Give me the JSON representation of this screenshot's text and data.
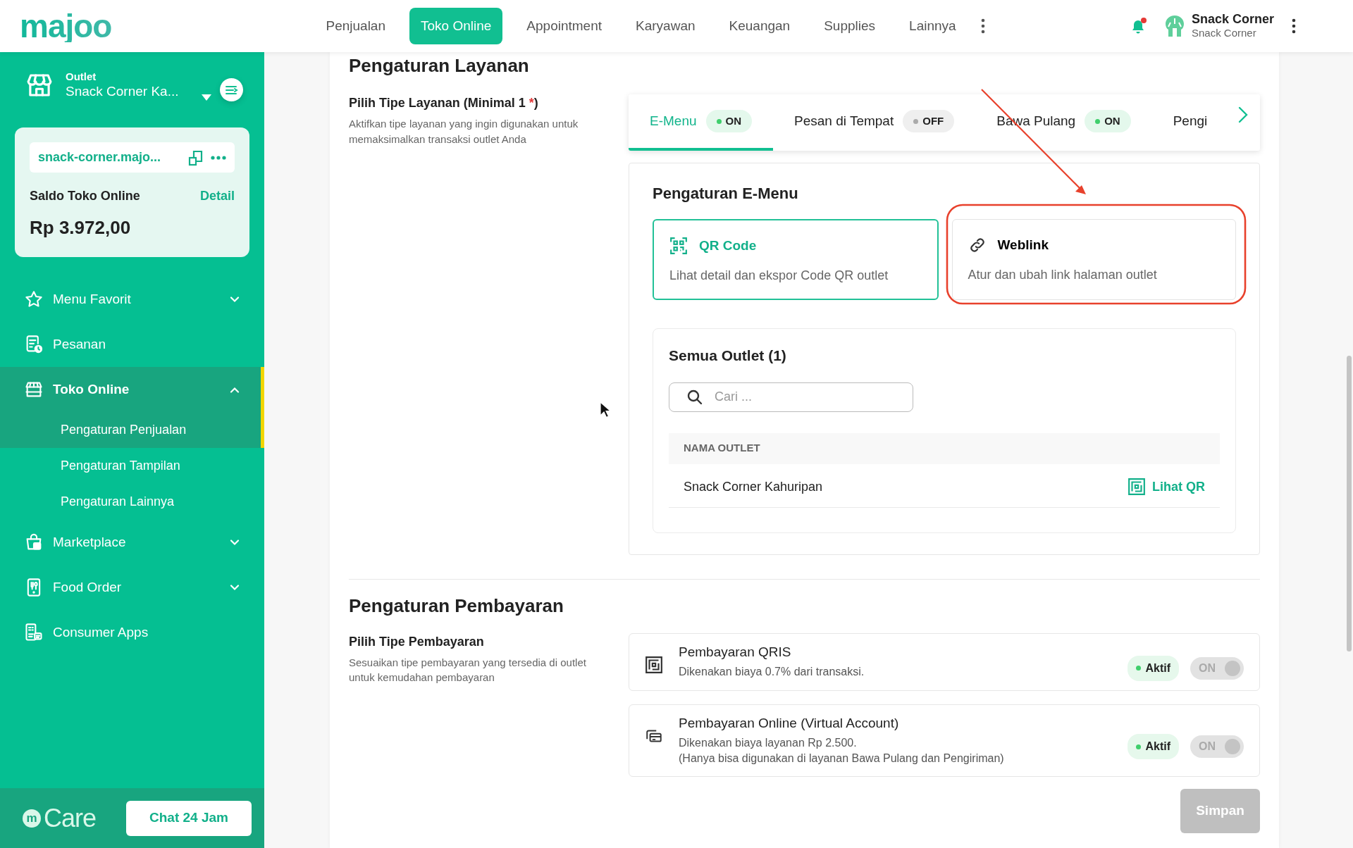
{
  "navbar": {
    "logo": "majoo",
    "menu": [
      {
        "label": "Penjualan",
        "selected": false
      },
      {
        "label": "Toko Online",
        "selected": true
      },
      {
        "label": "Appointment",
        "selected": false
      },
      {
        "label": "Karyawan",
        "selected": false
      },
      {
        "label": "Keuangan",
        "selected": false
      },
      {
        "label": "Supplies",
        "selected": false
      },
      {
        "label": "Lainnya",
        "selected": false
      }
    ],
    "notifications": {
      "unread": true
    },
    "user": {
      "name": "Snack Corner",
      "subtitle": "Snack Corner"
    }
  },
  "sidebar": {
    "outlet": {
      "label": "Outlet",
      "name": "Snack Corner Ka..."
    },
    "store": {
      "url": "snack-corner.majo...",
      "balance_label": "Saldo Toko Online",
      "detail": "Detail",
      "balance": "Rp 3.972,00"
    },
    "items": [
      {
        "kind": "group",
        "label": "Menu Favorit",
        "selected": false,
        "expanded": false
      },
      {
        "kind": "link",
        "label": "Pesanan",
        "selected": false
      },
      {
        "kind": "group",
        "label": "Toko Online",
        "selected": true,
        "expanded": true,
        "children": [
          {
            "label": "Pengaturan Penjualan",
            "selected": true
          },
          {
            "label": "Pengaturan Tampilan",
            "selected": false
          },
          {
            "label": "Pengaturan Lainnya",
            "selected": false
          }
        ]
      },
      {
        "kind": "group",
        "label": "Marketplace",
        "selected": false,
        "expanded": false
      },
      {
        "kind": "group",
        "label": "Food Order",
        "selected": false,
        "expanded": false
      },
      {
        "kind": "link",
        "label": "Consumer Apps",
        "selected": false
      }
    ],
    "care": {
      "mark": "m",
      "brand": "Care",
      "button": "Chat 24 Jam"
    }
  },
  "service": {
    "title": "Pengaturan Layanan",
    "label": "Pilih Tipe Layanan (Minimal 1",
    "required_mark": "*",
    "label_suffix": ")",
    "description": "Aktifkan tipe layanan yang ingin digunakan untuk memaksimalkan transaksi outlet Anda",
    "tabs": [
      {
        "label": "E-Menu",
        "status": "ON",
        "on": true,
        "selected": true
      },
      {
        "label": "Pesan di Tempat",
        "status": "OFF",
        "on": false,
        "selected": false
      },
      {
        "label": "Bawa Pulang",
        "status": "ON",
        "on": true,
        "selected": false
      },
      {
        "label": "Pengi",
        "selected": false
      }
    ],
    "panel": {
      "title": "Pengaturan E-Menu",
      "options": [
        {
          "title": "QR Code",
          "description": "Lihat detail dan ekspor Code QR outlet",
          "selected": true
        },
        {
          "title": "Weblink",
          "description": "Atur dan ubah link halaman outlet",
          "selected": false
        }
      ],
      "outlets": {
        "title": "Semua Outlet (1)",
        "search_placeholder": "Cari ...",
        "columns": [
          "NAMA OUTLET"
        ],
        "rows": [
          {
            "name": "Snack Corner Kahuripan",
            "action": "Lihat QR"
          }
        ]
      }
    }
  },
  "payment": {
    "title": "Pengaturan Pembayaran",
    "label": "Pilih Tipe Pembayaran",
    "description": "Sesuaikan tipe pembayaran yang tersedia di outlet untuk kemudahan pembayaran",
    "methods": [
      {
        "title": "Pembayaran QRIS",
        "description": [
          "Dikenakan biaya 0.7% dari transaksi."
        ],
        "status": "Aktif",
        "active": true,
        "toggle": "ON",
        "on": true,
        "disabled": true
      },
      {
        "title": "Pembayaran Online (Virtual Account)",
        "description": [
          "Dikenakan biaya layanan Rp 2.500.",
          "(Hanya bisa digunakan di layanan Bawa Pulang dan Pengiriman)"
        ],
        "status": "Aktif",
        "active": true,
        "toggle": "ON",
        "on": true,
        "disabled": true
      }
    ]
  },
  "save_button": {
    "label": "Simpan",
    "disabled": true
  }
}
